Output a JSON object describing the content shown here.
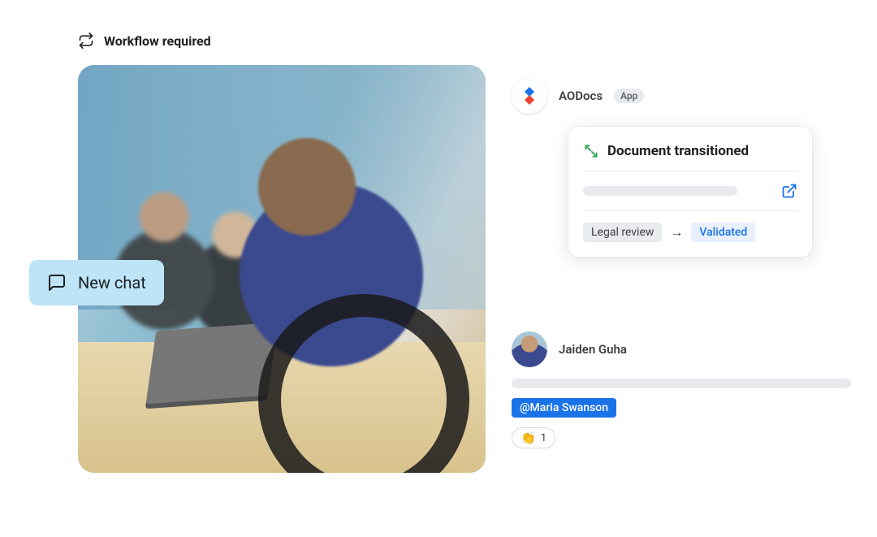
{
  "header": {
    "label": "Workflow required"
  },
  "chat_pill": {
    "label": "New chat"
  },
  "app": {
    "name": "AODocs",
    "badge": "App"
  },
  "doc_card": {
    "title": "Document transitioned",
    "from_tag": "Legal review",
    "to_tag": "Validated"
  },
  "message": {
    "user": "Jaiden Guha",
    "mention": "@Maria Swanson",
    "reaction_emoji": "👏",
    "reaction_count": "1"
  }
}
